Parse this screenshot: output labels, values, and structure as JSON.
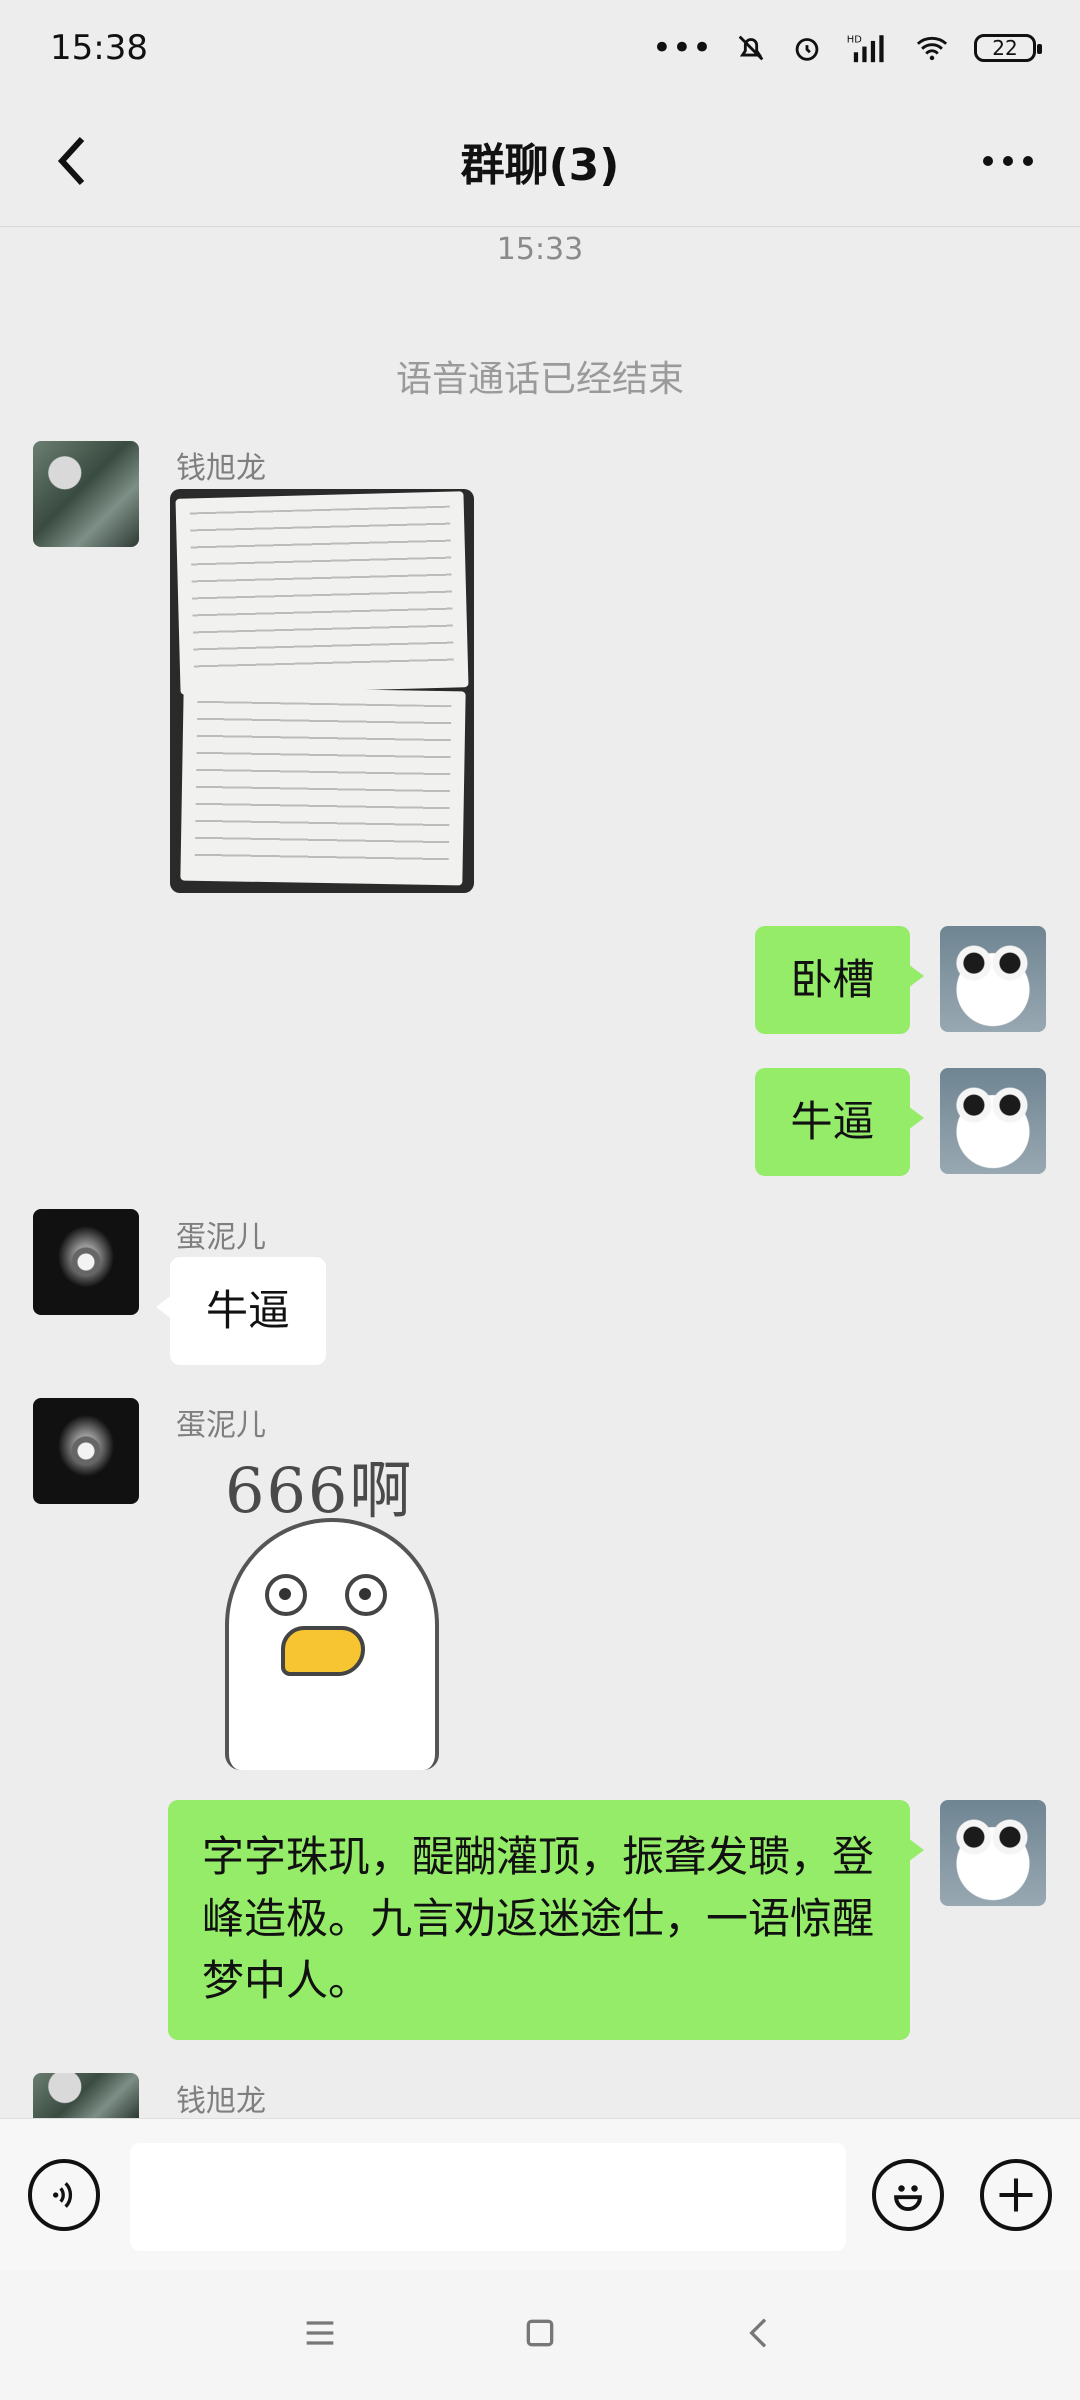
{
  "status_bar": {
    "time": "15:38",
    "battery": "22",
    "network_label": "HD"
  },
  "header": {
    "title": "群聊(3)"
  },
  "system": {
    "time": "15:33",
    "call_ended": "语音通话已经结束"
  },
  "messages": [
    {
      "sender": "钱旭龙",
      "type": "image"
    },
    {
      "sender": "me",
      "type": "text",
      "text": "卧槽"
    },
    {
      "sender": "me",
      "type": "text",
      "text": "牛逼"
    },
    {
      "sender": "蛋泥儿",
      "type": "text",
      "text": "牛逼"
    },
    {
      "sender": "蛋泥儿",
      "type": "sticker",
      "sticker_text": "666啊"
    },
    {
      "sender": "me",
      "type": "text",
      "text": "字字珠玑，醍醐灌顶，振聋发聩，登峰造极。九言劝返迷途仕，一语惊醒梦中人。"
    },
    {
      "sender": "钱旭龙",
      "type": "partial"
    }
  ],
  "input": {
    "value": ""
  },
  "colors": {
    "green_bubble": "#95ec69",
    "background": "#ededed"
  },
  "icons": [
    "back-arrow-icon",
    "more-dots-icon",
    "voice-icon",
    "emoji-icon",
    "plus-icon",
    "menu-icon",
    "home-icon",
    "back-nav-icon"
  ]
}
